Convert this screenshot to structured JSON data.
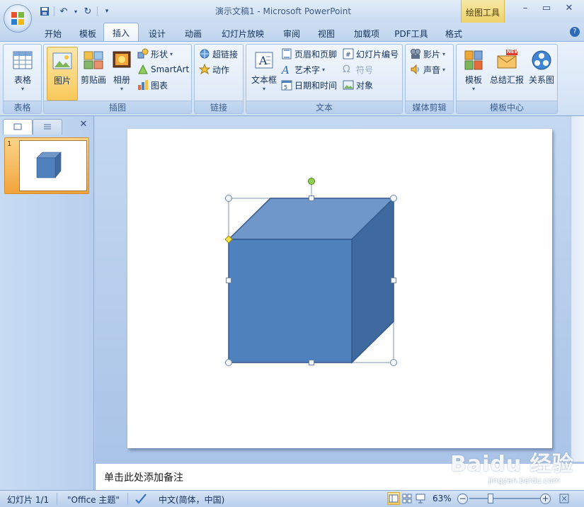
{
  "window": {
    "title": "演示文稿1 - Microsoft PowerPoint",
    "contextual_tab": "绘图工具",
    "controls": {
      "minimize": "–",
      "maximize": "▭",
      "close": "✕"
    }
  },
  "quick_access": {
    "save_icon": "save-icon",
    "undo_icon": "undo-icon",
    "redo_icon": "redo-icon",
    "customize_icon": "customize-icon"
  },
  "tabs": [
    "开始",
    "模板",
    "插入",
    "设计",
    "动画",
    "幻灯片放映",
    "审阅",
    "视图",
    "加载项",
    "PDF工具",
    "格式"
  ],
  "active_tab": "插入",
  "ribbon": {
    "groups": {
      "table": "表格",
      "illustrations": "插图",
      "links": "链接",
      "text": "文本",
      "media": "媒体剪辑",
      "template_center": "模板中心"
    },
    "buttons": {
      "table": "表格",
      "picture": "图片",
      "clipart": "剪贴画",
      "album": "相册",
      "shapes": "形状",
      "smartart": "SmartArt",
      "chart": "图表",
      "hyperlink": "超链接",
      "action": "动作",
      "textbox": "文本框",
      "header_footer": "页眉和页脚",
      "wordart": "艺术字",
      "datetime": "日期和时间",
      "slide_number": "幻灯片编号",
      "symbol": "符号",
      "object": "对象",
      "movie": "影片",
      "sound": "声音",
      "template": "模板",
      "report": "总结汇报",
      "relationship": "关系图",
      "new_badge": "NEW"
    }
  },
  "slides_pane": {
    "thumb_number": "1"
  },
  "notes": {
    "placeholder": "单击此处添加备注"
  },
  "status": {
    "slide_info": "幻灯片 1/1",
    "theme": "\"Office 主题\"",
    "language": "中文(简体，中国)",
    "zoom": "63%"
  },
  "watermark": {
    "main": "Baidu 经验",
    "sub": "jingyan.baidu.com"
  },
  "colors": {
    "cube_front": "#4f81bd",
    "cube_top": "#6f97c9",
    "cube_side": "#3f6aa0",
    "cube_stroke": "#35598a"
  }
}
